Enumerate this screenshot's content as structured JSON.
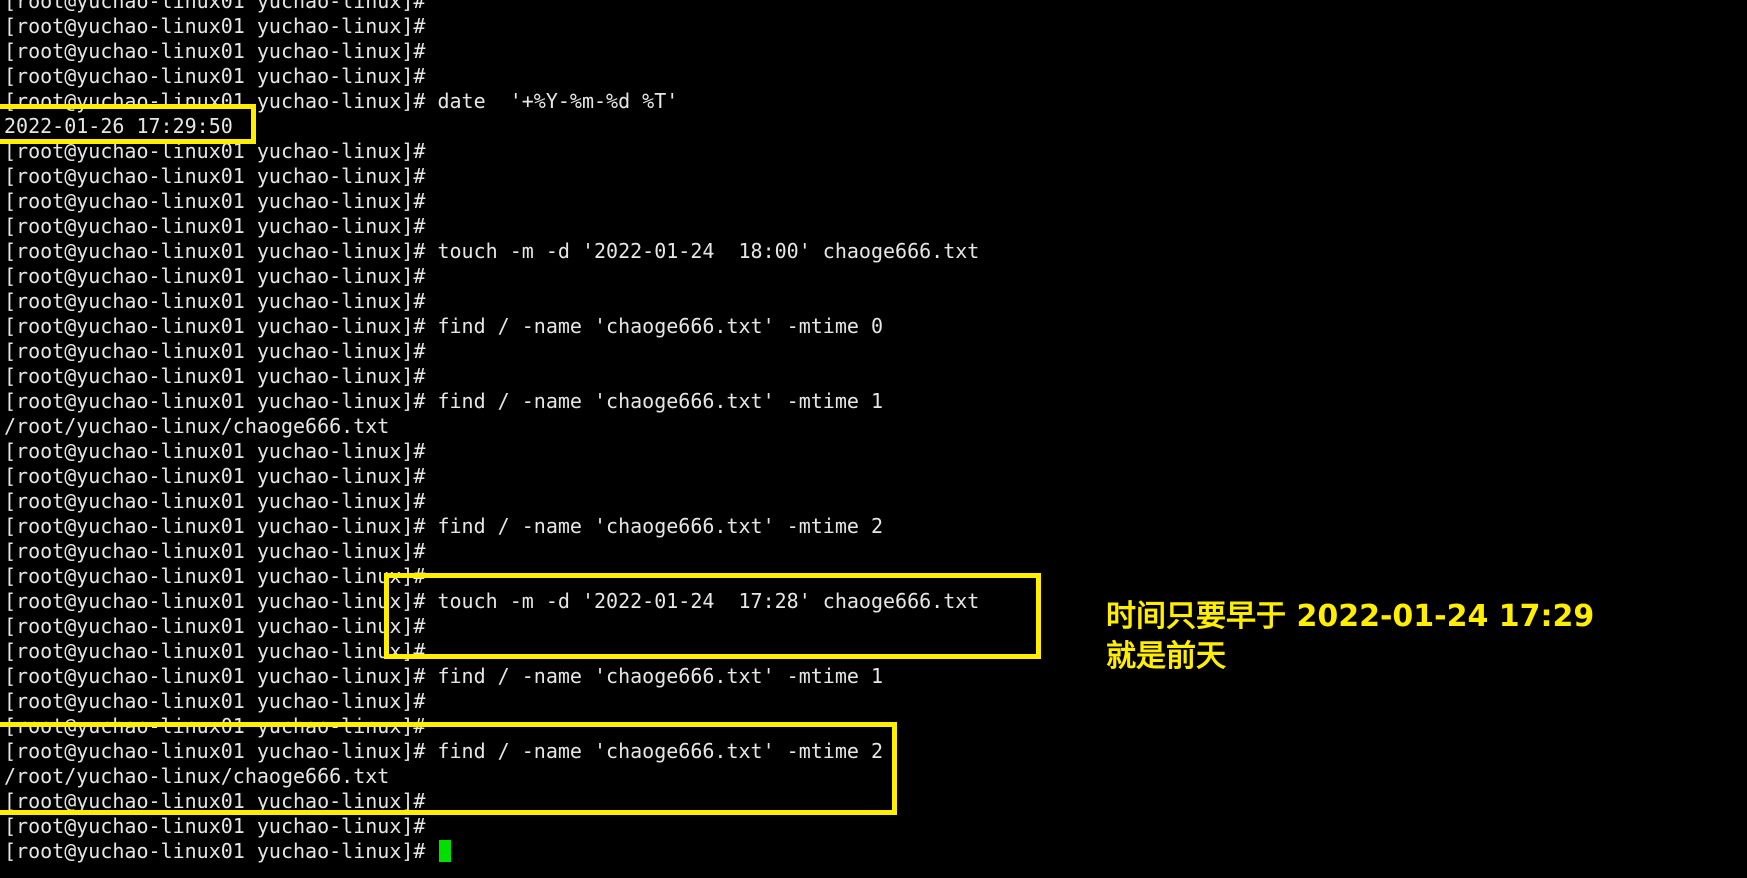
{
  "terminal": {
    "prompt": "[root@yuchao-linux01 yuchao-linux]#",
    "lines": [
      "[root@yuchao-linux01 yuchao-linux]#",
      "[root@yuchao-linux01 yuchao-linux]#",
      "[root@yuchao-linux01 yuchao-linux]#",
      "[root@yuchao-linux01 yuchao-linux]#",
      "[root@yuchao-linux01 yuchao-linux]# date  '+%Y-%m-%d %T'",
      "2022-01-26 17:29:50",
      "[root@yuchao-linux01 yuchao-linux]#",
      "[root@yuchao-linux01 yuchao-linux]#",
      "[root@yuchao-linux01 yuchao-linux]#",
      "[root@yuchao-linux01 yuchao-linux]#",
      "[root@yuchao-linux01 yuchao-linux]# touch -m -d '2022-01-24  18:00' chaoge666.txt",
      "[root@yuchao-linux01 yuchao-linux]#",
      "[root@yuchao-linux01 yuchao-linux]#",
      "[root@yuchao-linux01 yuchao-linux]# find / -name 'chaoge666.txt' -mtime 0",
      "[root@yuchao-linux01 yuchao-linux]#",
      "[root@yuchao-linux01 yuchao-linux]#",
      "[root@yuchao-linux01 yuchao-linux]# find / -name 'chaoge666.txt' -mtime 1",
      "/root/yuchao-linux/chaoge666.txt",
      "[root@yuchao-linux01 yuchao-linux]#",
      "[root@yuchao-linux01 yuchao-linux]#",
      "[root@yuchao-linux01 yuchao-linux]#",
      "[root@yuchao-linux01 yuchao-linux]# find / -name 'chaoge666.txt' -mtime 2",
      "[root@yuchao-linux01 yuchao-linux]#",
      "[root@yuchao-linux01 yuchao-linux]#",
      "[root@yuchao-linux01 yuchao-linux]# touch -m -d '2022-01-24  17:28' chaoge666.txt",
      "[root@yuchao-linux01 yuchao-linux]#",
      "[root@yuchao-linux01 yuchao-linux]#",
      "[root@yuchao-linux01 yuchao-linux]# find / -name 'chaoge666.txt' -mtime 1",
      "[root@yuchao-linux01 yuchao-linux]#",
      "[root@yuchao-linux01 yuchao-linux]#",
      "[root@yuchao-linux01 yuchao-linux]# find / -name 'chaoge666.txt' -mtime 2",
      "/root/yuchao-linux/chaoge666.txt",
      "[root@yuchao-linux01 yuchao-linux]#",
      "[root@yuchao-linux01 yuchao-linux]#",
      "[root@yuchao-linux01 yuchao-linux]# "
    ],
    "cursor_color": "#00e000",
    "text_color": "#e6e6e6",
    "background": "#000000"
  },
  "annotation": {
    "line1": "时间只要早于 2022-01-24 17:29",
    "line2": "就是前天",
    "color": "#ffee00"
  },
  "highlight_color": "#ffee00"
}
